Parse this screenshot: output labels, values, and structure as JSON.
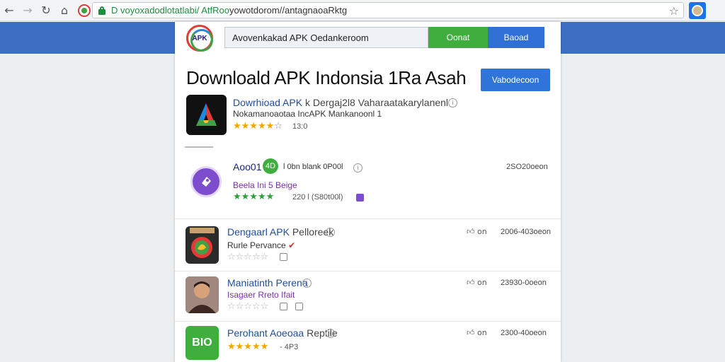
{
  "browser": {
    "url_secure": "D voyoxadodlotatlabi/ AtfRoo",
    "url_rest": "yowotdorom//antagnaoaRktg"
  },
  "header": {
    "logo_text": "APK",
    "search_value": "Avovenkakad APK Oedankeroom",
    "search_green_label": "Oonat",
    "search_blue_label": "Baoad"
  },
  "page": {
    "title": "Downloald APK Indonsia 1Ra Asah",
    "primary_button": "Vabodecoon"
  },
  "apps": [
    {
      "title": "Dowrhioad APK",
      "title_extra": "k Dergaj2l8 Vaharaatakarylanenl",
      "subtitle": "Nokamanoaotaa  IncAPK Mankanoonl  1",
      "subtitle_color": "#333333",
      "rating_filled": 4,
      "rating_total": 5,
      "meta": "13:0",
      "date": ""
    },
    {
      "title": "Aoo01",
      "badge": "4D",
      "title_extra": "l 0bn blank 0P00l",
      "subtitle": "Beela Ini 5 Beige",
      "subtitle_color": "#7b2fa8",
      "rating_filled": 5,
      "rating_total": 5,
      "meta": "220 l (S80t00l)",
      "date": "2SO20oeon"
    },
    {
      "title": "Dengaarl APK",
      "title_extra": " Pelloreek",
      "subtitle": "Rurle Pervance",
      "subtitle_color": "#333333",
      "rating_filled": 0,
      "rating_total": 5,
      "meta": "",
      "likes": "on",
      "date": "2006-403oeon"
    },
    {
      "title": "Maniatinth Perena",
      "title_extra": "",
      "subtitle": "Isagaer Rreto Ifait",
      "subtitle_color": "#7b2fa8",
      "rating_filled": 0,
      "rating_total": 5,
      "meta": "",
      "likes": "on",
      "date": "23930-0oeon"
    },
    {
      "title": "Perohant Aoeoaa",
      "title_extra": " Reptile",
      "subtitle": "",
      "subtitle_color": "#333333",
      "rating_filled": 5,
      "rating_total": 5,
      "meta": "- 4P3",
      "likes": "on",
      "date": "2300-40oeon",
      "icon_text": "BIO"
    }
  ],
  "colors": {
    "header_band": "#3c6fc4",
    "accent_green": "#3fae3f",
    "accent_blue": "#2f74d8",
    "star": "#f2a400"
  }
}
